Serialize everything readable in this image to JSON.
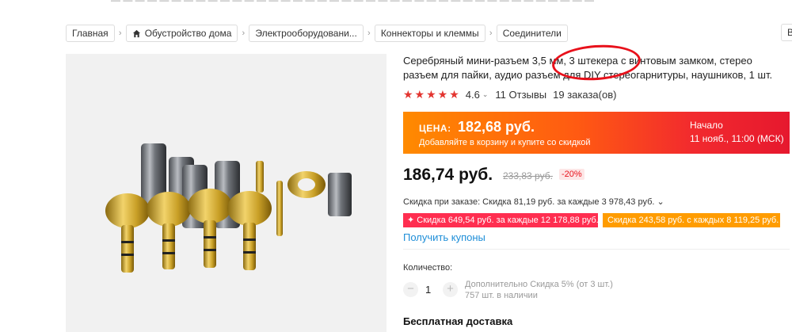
{
  "breadcrumb": {
    "items": [
      "Главная",
      "Обустройство дома",
      "Электрооборудовани...",
      "Коннекторы и клеммы",
      "Соединители"
    ],
    "edge_fragment": "В"
  },
  "product": {
    "title": "Серебряный мини-разъем 3,5 мм, 3 штекера с винтовым замком, стерео разъем для пайки, аудио разъем для DIY стереогарнитуры, наушников, 1 шт.",
    "rating": "4.6",
    "reviews": "11 Отзывы",
    "orders": "19 заказа(ов)",
    "stars": "★★★★★"
  },
  "promo": {
    "label": "ЦЕНА:",
    "price": "182,68 руб.",
    "subtitle": "Добавляйте в корзину и купите со скидкой",
    "start_label": "Начало",
    "start_date": "11 нояб., 11:00 (МСК)",
    "gradient_start": "#ff8a00",
    "gradient_end": "#e6182e"
  },
  "pricing": {
    "price": "186,74 руб.",
    "old_price": "233,83 руб.",
    "discount": "-20%"
  },
  "discounts": {
    "order_discount": "Скидка при заказе: Скидка 81,19 руб. за каждые 3 978,43 руб.",
    "coupon1": "Скидка 649,54 руб. за каждые 12 178,88 руб.",
    "coupon2": "Скидка 243,58 руб. с каждых 8 119,25 руб.",
    "get_coupons": "Получить купоны"
  },
  "quantity": {
    "label": "Количество:",
    "value": "1",
    "minus": "−",
    "plus": "+",
    "extra_discount": "Дополнительно Скидка 5% (от 3 шт.)",
    "available": "757 шт. в наличии"
  },
  "shipping": {
    "title": "Бесплатная доставка"
  },
  "colors": {
    "accent_red": "#e8111b",
    "link_blue": "#1e8ed8",
    "coupon_pink": "#ff2e50",
    "coupon_orange": "#ff9c00"
  }
}
